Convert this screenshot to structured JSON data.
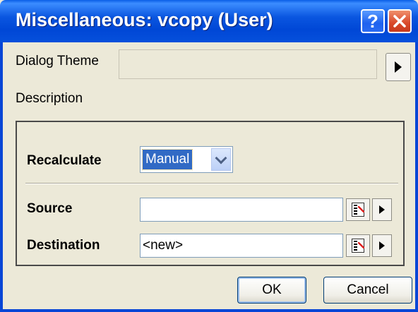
{
  "window": {
    "title": "Miscellaneous: vcopy (User)"
  },
  "title_buttons": {
    "help": "?",
    "close": "close"
  },
  "theme": {
    "label": "Dialog Theme",
    "value": ""
  },
  "description": {
    "label": "Description"
  },
  "form": {
    "recalculate": {
      "label": "Recalculate",
      "value": "Manual"
    },
    "source": {
      "label": "Source",
      "value": ""
    },
    "destination": {
      "label": "Destination",
      "value": "<new>"
    }
  },
  "buttons": {
    "ok": "OK",
    "cancel": "Cancel"
  },
  "icons": {
    "help": "help-icon",
    "close": "close-icon",
    "arrow": "arrow-right-icon",
    "dropdown": "chevron-down-icon",
    "sheet": "worksheet-select-icon"
  },
  "colors": {
    "titlebar": "#0a56e0",
    "dialog_bg": "#ece9d8",
    "selection": "#316ac5",
    "close_button": "#d9482a"
  }
}
